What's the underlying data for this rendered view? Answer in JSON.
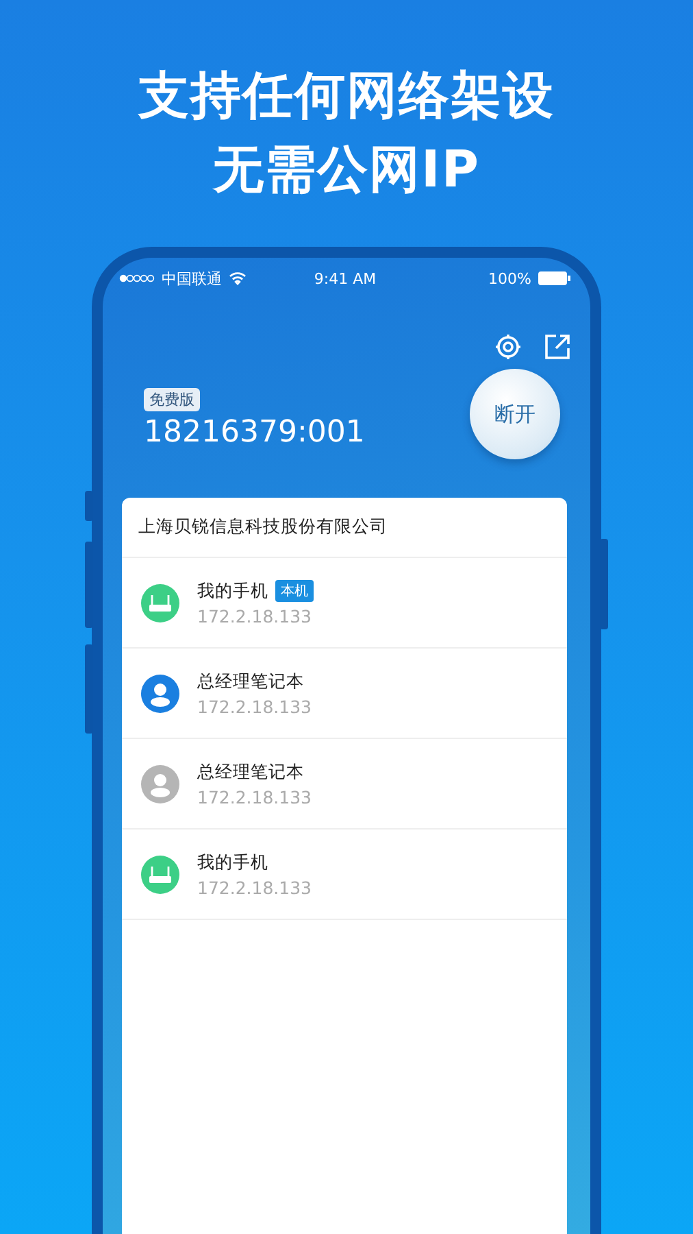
{
  "headline": [
    "支持任何网络架设",
    "无需公网IP"
  ],
  "status_bar": {
    "carrier": "中国联通",
    "time": "9:41 AM",
    "battery": "100%"
  },
  "account": {
    "plan_badge": "免费版",
    "id": "18216379:001",
    "disconnect_button": "断开"
  },
  "network": {
    "name": "上海贝锐信息科技股份有限公司",
    "devices": [
      {
        "kind": "router",
        "color": "#3ccf86",
        "name": "我的手机",
        "tag": "本机",
        "ip": "172.2.18.133"
      },
      {
        "kind": "person",
        "color": "#1a7fe0",
        "name": "总经理笔记本",
        "ip": "172.2.18.133"
      },
      {
        "kind": "person",
        "color": "#b5b5b5",
        "name": "总经理笔记本",
        "ip": "172.2.18.133"
      },
      {
        "kind": "router",
        "color": "#3ccf86",
        "name": "我的手机",
        "ip": "172.2.18.133"
      }
    ]
  }
}
